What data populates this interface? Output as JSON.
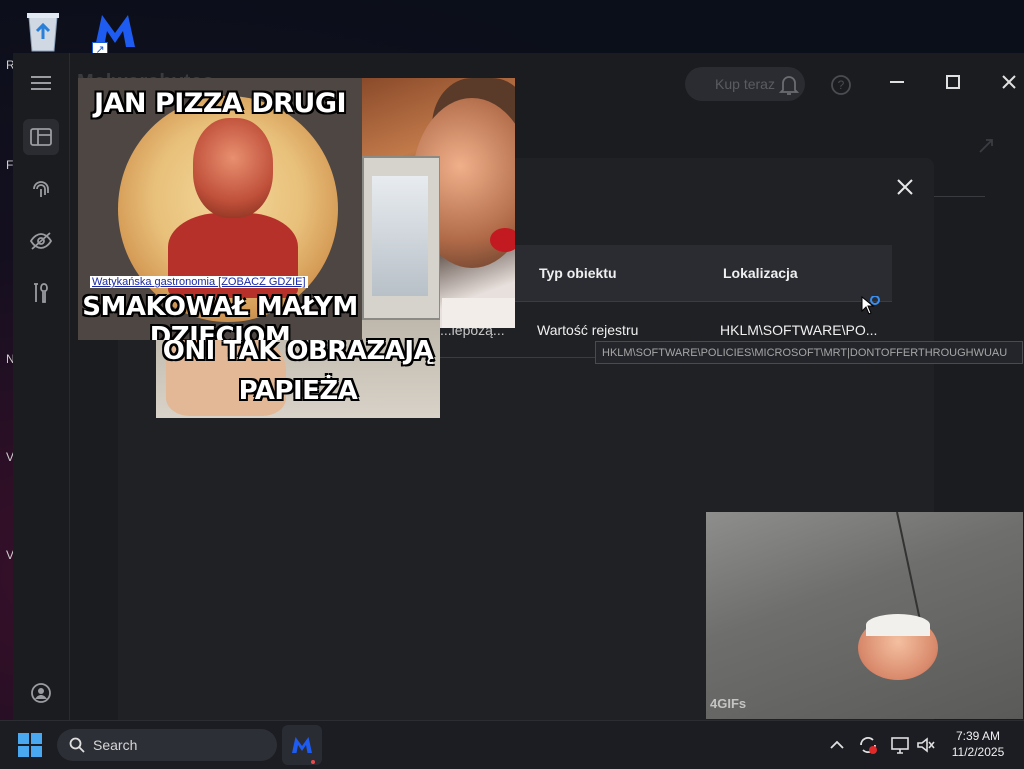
{
  "desktop": {
    "icons": [
      "recycle-bin",
      "malwarebytes"
    ],
    "edge_letters": [
      "R",
      "F",
      "N",
      "Vi",
      "V"
    ]
  },
  "app": {
    "brand": "Malwarebytes",
    "buy_button": "Kup teraz",
    "sidebar": [
      "dashboard",
      "fingerprint",
      "privacy",
      "tools",
      "account"
    ]
  },
  "dialog": {
    "columns": [
      "Typ obiektu",
      "Lokalizacja"
    ],
    "rows": [
      {
        "truncated_prefix": "...iepożą...",
        "type": "Wartość rejestru",
        "location": "HKLM\\SOFTWARE\\PO..."
      }
    ],
    "tooltip": "HKLM\\SOFTWARE\\POLICIES\\MICROSOFT\\MRT|DONTOFFERTHROUGHWUAU"
  },
  "overlays": {
    "pizza_meme": {
      "top": "JAN PIZZA DRUGI",
      "bottom": "SMAKOWAŁ MAŁYM DZIECIOM",
      "link": "Watykańska gastronomia [ZOBACZ GDZIE]"
    },
    "pc_meme": {
      "line1": "ONI TAK OBRAZAJĄ",
      "line2": "PAPIEŻA"
    },
    "gif_watermark": "4GIFs"
  },
  "taskbar": {
    "search": "Search",
    "time": "7:39 AM",
    "date": "11/2/2025"
  },
  "colors": {
    "accent": "#2a63e8",
    "taskbar": "#1c1d22",
    "app_bg": "#1b1c1f"
  }
}
